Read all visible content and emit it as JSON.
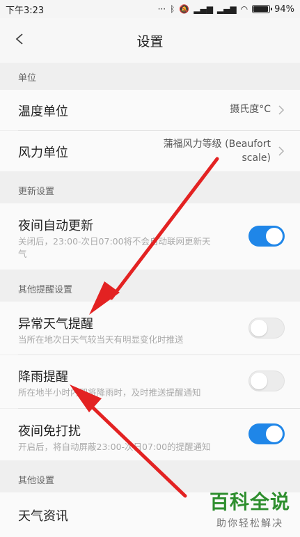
{
  "status_bar": {
    "time": "下午3:23",
    "battery_text": "94%",
    "battery_level": 0.94
  },
  "header": {
    "title": "设置"
  },
  "sections": {
    "units": {
      "header": "单位",
      "temperature": {
        "label": "温度单位",
        "value": "摄氏度°C"
      },
      "wind": {
        "label": "风力单位",
        "value_line1": "蒲福风力等级 (Beaufort",
        "value_line2": "scale)"
      }
    },
    "update": {
      "header": "更新设置",
      "night_update": {
        "label": "夜间自动更新",
        "desc_line1": "关闭后，23:00-次日07:00将不会自动联网更新天",
        "desc_line2": "气",
        "enabled": true
      }
    },
    "alerts": {
      "header": "其他提醒设置",
      "abnormal": {
        "label": "异常天气提醒",
        "desc": "当所在地次日天气较当天有明显变化时推送",
        "enabled": false
      },
      "rain": {
        "label": "降雨提醒",
        "desc": "所在地半小时内即将降雨时，及时推送提醒通知",
        "enabled": false
      },
      "dnd": {
        "label": "夜间免打扰",
        "desc": "开启后，将自动屏蔽23:00-次日07:00的提醒通知",
        "enabled": true
      }
    },
    "other": {
      "header": "其他设置",
      "weather_news": {
        "label": "天气资讯"
      }
    }
  },
  "watermark": {
    "main": "百科全说",
    "sub": "助你轻松解决"
  },
  "colors": {
    "toggle_on": "#1f86e8",
    "arrow": "#e32222",
    "watermark": "#2f8f2f"
  }
}
